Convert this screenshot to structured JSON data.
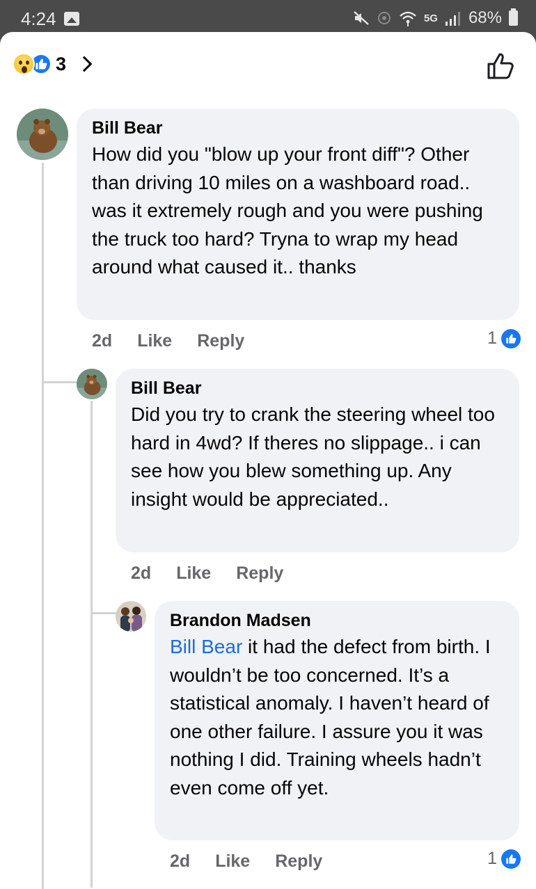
{
  "status_bar": {
    "time": "4:24",
    "network": "5G",
    "battery": "68%",
    "icons": [
      "gallery-icon",
      "mute-icon",
      "hotspot-icon",
      "wifi-icon",
      "signal-icon",
      "battery-icon"
    ]
  },
  "reactions": {
    "count": "3",
    "types": [
      "wow",
      "like"
    ]
  },
  "comments": [
    {
      "author": "Bill Bear",
      "text": "How did you \"blow up your front diff\"? Other than driving 10 miles on a washboard road.. was it extremely rough and you were pushing the truck too hard? Tryna to wrap my head around what caused it.. thanks",
      "time": "2d",
      "like_label": "Like",
      "reply_label": "Reply",
      "reaction_count": "1"
    },
    {
      "author": "Bill Bear",
      "text": "Did you try to crank the steering wheel too hard in 4wd? If theres no slippage.. i can see how you blew something up. Any insight would be appreciated..",
      "time": "2d",
      "like_label": "Like",
      "reply_label": "Reply"
    },
    {
      "author": "Brandon Madsen",
      "mention": "Bill Bear",
      "text": " it had the defect from birth. I wouldn’t be too concerned. It’s a statistical anomaly. I haven’t heard of one other failure. I assure you it was nothing I did. Training wheels hadn’t even come off yet.",
      "time": "2d",
      "like_label": "Like",
      "reply_label": "Reply",
      "reaction_count": "1"
    }
  ],
  "colors": {
    "like_blue": "#1877f2",
    "mention_blue": "#1a6ed8",
    "bubble_bg": "#f0f2f5",
    "meta_gray": "#65676b"
  }
}
